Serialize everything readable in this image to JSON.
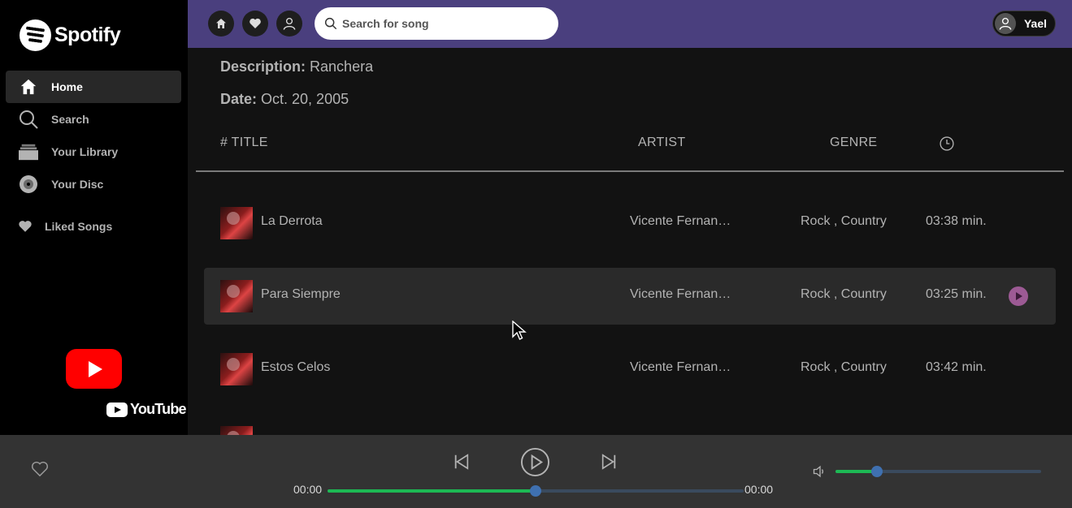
{
  "sidebar": {
    "brand": "Spotify",
    "items": [
      {
        "label": "Home",
        "icon": "home-icon"
      },
      {
        "label": "Search",
        "icon": "search-icon"
      },
      {
        "label": "Your Library",
        "icon": "library-icon"
      },
      {
        "label": "Your Disc",
        "icon": "disc-icon"
      }
    ],
    "liked": "Liked Songs",
    "ad_brand": "YouTube"
  },
  "topbar": {
    "search_placeholder": "Search for song",
    "user_name": "Yael"
  },
  "album": {
    "description_label": "Description:",
    "description": "Ranchera",
    "date_label": "Date:",
    "date": "Oct. 20, 2005"
  },
  "table": {
    "headers": {
      "title": "# TITLE",
      "artist": "ARTIST",
      "genre": "GENRE"
    },
    "rows": [
      {
        "title": "La Derrota",
        "artist": "Vicente Fernan…",
        "genre": "Rock , Country",
        "duration": "03:38 min."
      },
      {
        "title": "Para Siempre",
        "artist": "Vicente Fernan…",
        "genre": "Rock , Country",
        "duration": "03:25 min."
      },
      {
        "title": "Estos Celos",
        "artist": "Vicente Fernan…",
        "genre": "Rock , Country",
        "duration": "03:42 min."
      }
    ]
  },
  "player": {
    "current_time": "00:00",
    "total_time": "00:00",
    "progress": 0.5,
    "volume": 0.2
  },
  "colors": {
    "topbar": "#4a3f7e",
    "accent_green": "#1db954",
    "youtube_red": "#ff0000"
  }
}
